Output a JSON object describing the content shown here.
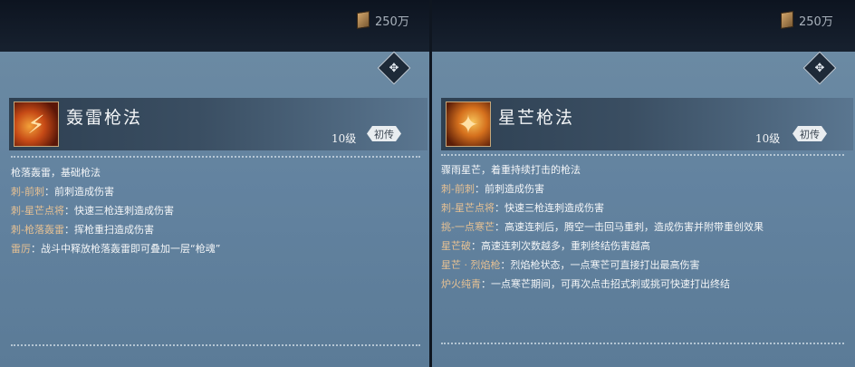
{
  "left_panel": {
    "currency": "250万",
    "skill_name": "轰雷枪法",
    "level": "10级",
    "badge": "初传",
    "lines": [
      {
        "tag": "",
        "text": "枪落轰雷，基础枪法"
      },
      {
        "tag": "刺-前刺",
        "text": "：前刺造成伤害"
      },
      {
        "tag": "刺-星芒点将",
        "text": "：快速三枪连刺造成伤害"
      },
      {
        "tag": "刺-枪落轰雷",
        "text": "：挥枪重扫造成伤害"
      },
      {
        "tag": "雷厉",
        "text": "：战斗中释放枪落轰雷即可叠加一层“枪魂”"
      }
    ]
  },
  "right_panel": {
    "currency": "250万",
    "skill_name": "星芒枪法",
    "level": "10级",
    "badge": "初传",
    "lines": [
      {
        "tag": "",
        "text": "骤雨星芒，着重持续打击的枪法"
      },
      {
        "tag": "刺-前刺",
        "text": "：前刺造成伤害"
      },
      {
        "tag": "刺-星芒点将",
        "text": "：快速三枪连刺造成伤害"
      },
      {
        "tag": "挑-一点寒芒",
        "text": "：高速连刺后，腾空一击回马重刺，造成伤害并附带重创效果"
      },
      {
        "tag": "星芒破",
        "text": "：高速连刺次数越多，重刺终结伤害越高"
      },
      {
        "tag": "星芒 · 烈焰枪",
        "text": "：烈焰枪状态，一点寒芒可直接打出最高伤害"
      },
      {
        "tag": "炉火纯青",
        "text": "：一点寒芒期间，可再次点击招式刺或挑可快速打出终结"
      }
    ]
  },
  "colors": {
    "panel_bg": "#5e7f99",
    "topbar_bg": "#101826",
    "tag_color": "#e7c193",
    "text_color": "#f4f6f8"
  },
  "icons": {
    "currency": "coin-scroll-icon",
    "expand": "expand-diamond-icon",
    "left_skill": "lightning-spear-icon",
    "right_skill": "star-spear-icon"
  }
}
